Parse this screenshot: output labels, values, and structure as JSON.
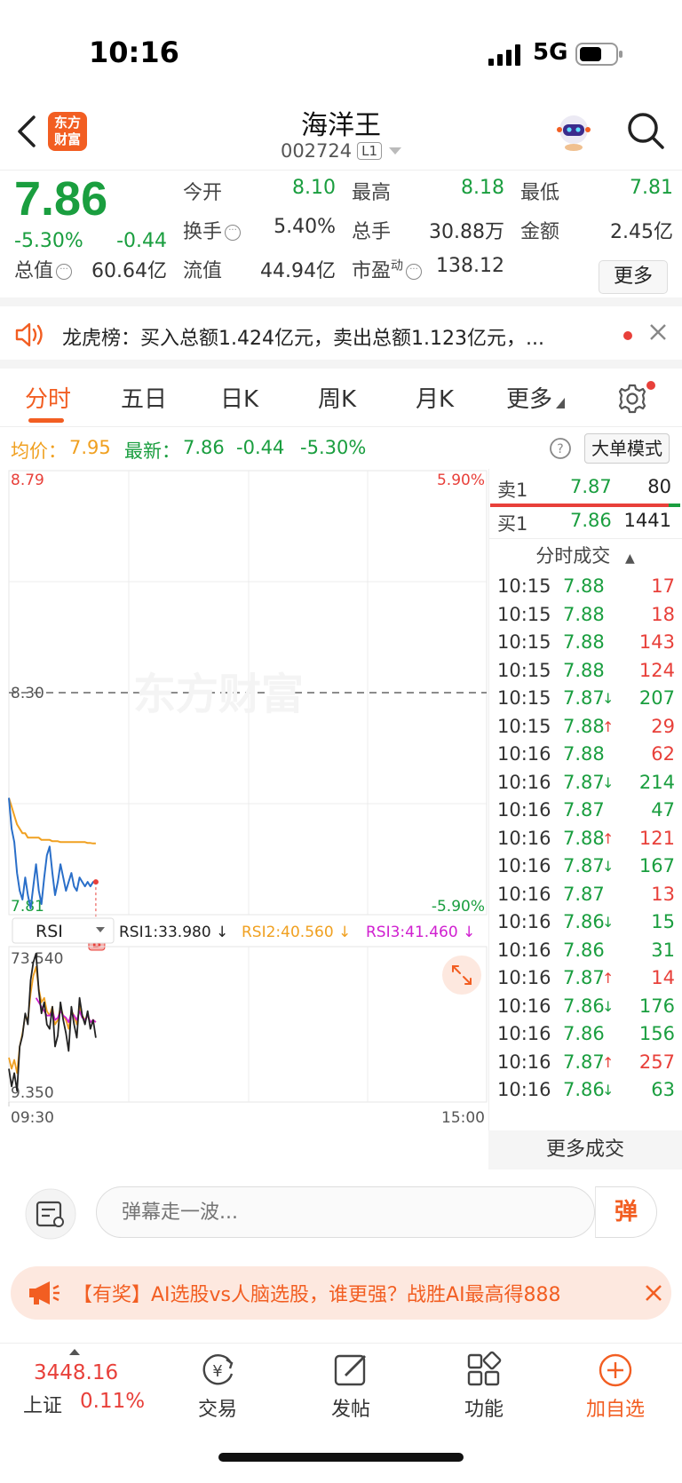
{
  "status": {
    "time": "10:16",
    "network": "5G"
  },
  "header": {
    "logo_line1": "东方",
    "logo_line2": "财富",
    "stock_name": "海洋王",
    "stock_code": "002724",
    "level": "L1"
  },
  "quote": {
    "price": "7.86",
    "change_pct": "-5.30%",
    "change_amt": "-0.44",
    "open_label": "今开",
    "open_value": "8.10",
    "high_label": "最高",
    "high_value": "8.18",
    "low_label": "最低",
    "low_value": "7.81",
    "turnover_label": "换手",
    "turnover_value": "5.40%",
    "volume_label": "总手",
    "volume_value": "30.88万",
    "amount_label": "金额",
    "amount_value": "2.45亿",
    "mktcap_label": "总值",
    "mktcap_value": "60.64亿",
    "float_label": "流值",
    "float_value": "44.94亿",
    "pe_label": "市盈",
    "pe_sup": "动",
    "pe_value": "138.12",
    "more_label": "更多"
  },
  "news": {
    "text": "龙虎榜：买入总额1.424亿元，卖出总额1.123亿元，..."
  },
  "tabs": [
    "分时",
    "五日",
    "日K",
    "周K",
    "月K",
    "更多"
  ],
  "summary": {
    "avg_label": "均价：",
    "avg_value": "7.95",
    "last_label": "最新：",
    "last_value": "7.86",
    "chg_amt": "-0.44",
    "chg_pct": "-5.30%",
    "mode_label": "大单模式"
  },
  "chart_data": {
    "type": "line",
    "price_axis": {
      "top": "8.79",
      "mid": "8.30",
      "bottom": "7.81"
    },
    "pct_axis": {
      "top": "5.90%",
      "bottom": "-5.90%"
    },
    "watermark": "东方财富",
    "price_series": [
      8.05,
      7.98,
      7.95,
      7.88,
      7.84,
      7.82,
      7.87,
      7.83,
      7.8,
      7.85,
      7.9,
      7.84,
      7.81,
      7.87,
      7.92,
      7.94,
      7.88,
      7.83,
      7.86,
      7.9,
      7.87,
      7.84,
      7.86,
      7.88,
      7.85,
      7.84,
      7.87,
      7.86,
      7.85,
      7.86,
      7.85,
      7.86,
      7.86
    ],
    "avg_series": [
      8.05,
      8.03,
      8.01,
      7.99,
      7.98,
      7.97,
      7.97,
      7.96,
      7.96,
      7.96,
      7.96,
      7.96,
      7.955,
      7.955,
      7.955,
      7.955,
      7.952,
      7.952,
      7.952,
      7.95,
      7.95,
      7.95,
      7.95,
      7.95,
      7.95,
      7.95,
      7.95,
      7.95,
      7.95,
      7.948,
      7.948,
      7.947,
      7.947
    ],
    "buy_marker": "B",
    "x_start": "09:30",
    "x_end": "15:00",
    "rsi": {
      "label": "RSI",
      "rsi1_label": "RSI1:33.980",
      "rsi2_label": "RSI2:40.560",
      "rsi3_label": "RSI3:41.460",
      "top": "73.540",
      "bottom": "9.350",
      "rsi1": [
        20,
        12,
        18,
        10,
        30,
        35,
        45,
        40,
        60,
        68,
        72,
        55,
        45,
        50,
        40,
        38,
        48,
        30,
        35,
        50,
        42,
        36,
        28,
        48,
        40,
        34,
        52,
        44,
        40,
        46,
        38,
        42,
        34
      ],
      "rsi2": [
        25,
        20,
        24,
        18,
        30,
        36,
        44,
        42,
        54,
        62,
        66,
        56,
        50,
        52,
        46,
        44,
        48,
        40,
        42,
        48,
        44,
        42,
        38,
        46,
        44,
        40,
        48,
        44,
        42,
        44,
        41,
        42,
        41
      ],
      "rsi3": [
        null,
        null,
        null,
        null,
        null,
        null,
        null,
        null,
        null,
        null,
        52,
        50,
        48,
        46,
        44,
        44,
        46,
        42,
        43,
        46,
        44,
        43,
        41,
        45,
        44,
        42,
        46,
        43,
        42,
        44,
        41,
        42,
        41
      ]
    }
  },
  "order_book": {
    "sell_label": "卖1",
    "sell_price": "7.87",
    "sell_vol": "80",
    "buy_label": "买1",
    "buy_price": "7.86",
    "buy_vol": "1441",
    "sell_ratio": 0.06
  },
  "ticks_title": "分时成交",
  "ticks": [
    {
      "t": "10:15",
      "p": "7.88",
      "d": "",
      "v": "17"
    },
    {
      "t": "10:15",
      "p": "7.88",
      "d": "",
      "v": "18"
    },
    {
      "t": "10:15",
      "p": "7.88",
      "d": "",
      "v": "143"
    },
    {
      "t": "10:15",
      "p": "7.88",
      "d": "",
      "v": "124"
    },
    {
      "t": "10:15",
      "p": "7.87",
      "d": "↓",
      "v": "207"
    },
    {
      "t": "10:15",
      "p": "7.88",
      "d": "↑",
      "v": "29"
    },
    {
      "t": "10:16",
      "p": "7.88",
      "d": "",
      "v": "62"
    },
    {
      "t": "10:16",
      "p": "7.87",
      "d": "↓",
      "v": "214"
    },
    {
      "t": "10:16",
      "p": "7.87",
      "d": "",
      "v": "47"
    },
    {
      "t": "10:16",
      "p": "7.88",
      "d": "↑",
      "v": "121"
    },
    {
      "t": "10:16",
      "p": "7.87",
      "d": "↓",
      "v": "167"
    },
    {
      "t": "10:16",
      "p": "7.87",
      "d": "",
      "v": "13"
    },
    {
      "t": "10:16",
      "p": "7.86",
      "d": "↓",
      "v": "15"
    },
    {
      "t": "10:16",
      "p": "7.86",
      "d": "",
      "v": "31"
    },
    {
      "t": "10:16",
      "p": "7.87",
      "d": "↑",
      "v": "14"
    },
    {
      "t": "10:16",
      "p": "7.86",
      "d": "↓",
      "v": "176"
    },
    {
      "t": "10:16",
      "p": "7.86",
      "d": "",
      "v": "156"
    },
    {
      "t": "10:16",
      "p": "7.87",
      "d": "↑",
      "v": "257"
    },
    {
      "t": "10:16",
      "p": "7.86",
      "d": "↓",
      "v": "63"
    }
  ],
  "more_ticks_label": "更多成交",
  "comment": {
    "placeholder": "弹幕走一波...",
    "danmaku_label": "弹"
  },
  "promo": {
    "text": "【有奖】AI选股vs人脑选股，谁更强？战胜AI最高得888"
  },
  "bottom_nav": {
    "index_value": "3448.16",
    "index_name": "上证",
    "index_pct": "0.11%",
    "items": [
      "交易",
      "发帖",
      "功能",
      "加自选"
    ]
  },
  "colors": {
    "accent": "#f25e22",
    "down": "#1a9e3f",
    "up": "#e8403a",
    "avg": "#f0a020",
    "price_line": "#2a6fc9",
    "rsi3": "#d020d0"
  }
}
